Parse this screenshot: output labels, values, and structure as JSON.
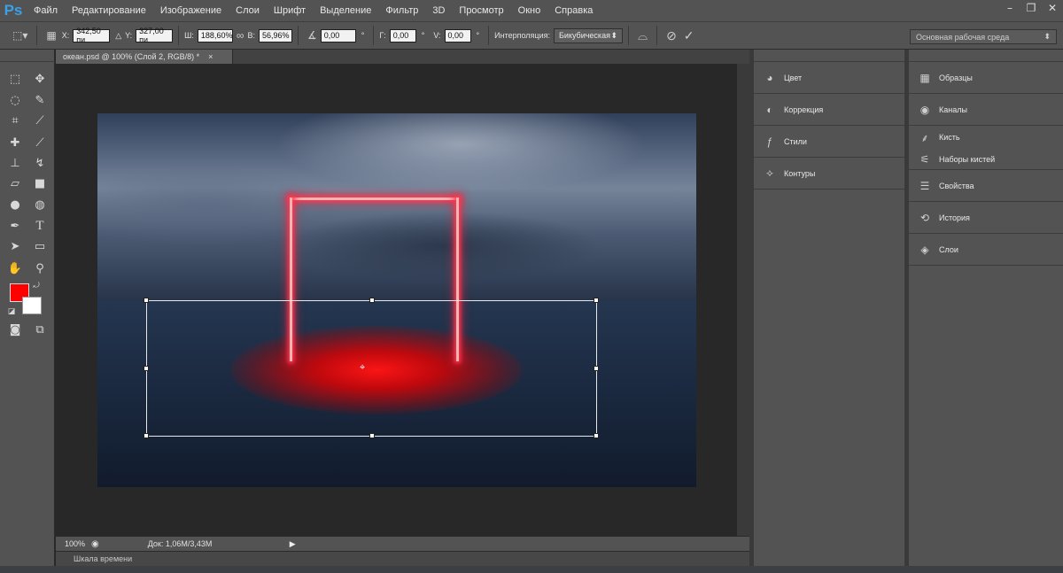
{
  "app": {
    "logo": "Ps"
  },
  "menu": [
    "Файл",
    "Редактирование",
    "Изображение",
    "Слои",
    "Шрифт",
    "Выделение",
    "Фильтр",
    "3D",
    "Просмотр",
    "Окно",
    "Справка"
  ],
  "window_controls": {
    "minimize": "–",
    "restore": "❐",
    "close": "✕"
  },
  "options": {
    "x_label": "X:",
    "x_value": "342,50 пи",
    "y_label": "Y:",
    "y_value": "327,00 пи",
    "w_label": "Ш:",
    "w_value": "188,60%",
    "h_label": "В:",
    "h_value": "56,96%",
    "angle_value": "0,00",
    "angle_unit": "°",
    "hskew_label": "Г:",
    "hskew_value": "0,00",
    "hskew_unit": "°",
    "vskew_label": "V:",
    "vskew_value": "0,00",
    "vskew_unit": "°",
    "interp_label": "Интерполяция:",
    "interp_value": "Бикубическая",
    "workspace": "Основная рабочая среда"
  },
  "document": {
    "tab_title": "океан.psd @ 100% (Слой 2, RGB/8) *",
    "tab_close": "×"
  },
  "status": {
    "zoom": "100%",
    "doc_size": "Док: 1,06M/3,43M"
  },
  "timeline": {
    "label": "Шкала времени"
  },
  "colors": {
    "foreground": "#ff0000",
    "background": "#ffffff"
  },
  "panels_mid": [
    {
      "label": "Цвет",
      "icon": "palette-icon"
    },
    {
      "label": "Коррекция",
      "icon": "adjustments-icon"
    },
    {
      "label": "Стили",
      "icon": "styles-icon"
    },
    {
      "label": "Контуры",
      "icon": "paths-icon"
    }
  ],
  "panels_right": [
    {
      "label": "Образцы",
      "icon": "swatches-icon"
    },
    {
      "label": "Каналы",
      "icon": "channels-icon"
    },
    {
      "label": "Кисть",
      "icon": "brush-icon"
    },
    {
      "label": "Наборы кистей",
      "icon": "brush-presets-icon"
    },
    {
      "label": "Свойства",
      "icon": "properties-icon"
    },
    {
      "label": "История",
      "icon": "history-icon"
    },
    {
      "label": "Слои",
      "icon": "layers-icon"
    }
  ]
}
